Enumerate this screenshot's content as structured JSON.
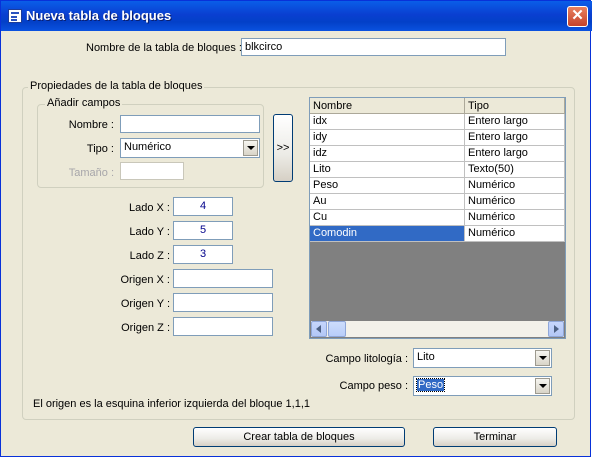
{
  "window": {
    "title": "Nueva tabla de bloques"
  },
  "name_field": {
    "label": "Nombre de la tabla de bloques :",
    "value": "blkcirco"
  },
  "properties_group": {
    "title": "Propiedades de la tabla de bloques"
  },
  "add_fields_group": {
    "title": "Añadir campos",
    "name_label": "Nombre :",
    "name_value": "",
    "type_label": "Tipo :",
    "type_value": "Numérico",
    "size_label": "Tamaño :",
    "size_value": "",
    "add_button_label": ">>"
  },
  "dimensions": {
    "lado_x": {
      "label": "Lado X :",
      "value": "4"
    },
    "lado_y": {
      "label": "Lado Y :",
      "value": "5"
    },
    "lado_z": {
      "label": "Lado Z :",
      "value": "3"
    },
    "origen_x": {
      "label": "Origen X :",
      "value": ""
    },
    "origen_y": {
      "label": "Origen Y :",
      "value": ""
    },
    "origen_z": {
      "label": "Origen Z :",
      "value": ""
    }
  },
  "fields_table": {
    "columns": [
      "Nombre",
      "Tipo"
    ],
    "rows": [
      [
        "idx",
        "Entero largo"
      ],
      [
        "idy",
        "Entero largo"
      ],
      [
        "idz",
        "Entero largo"
      ],
      [
        "Lito",
        "Texto(50)"
      ],
      [
        "Peso",
        "Numérico"
      ],
      [
        "Au",
        "Numérico"
      ],
      [
        "Cu",
        "Numérico"
      ],
      [
        "Comodin",
        "Numérico"
      ]
    ],
    "selected_row": 7
  },
  "campo_litologia": {
    "label": "Campo litología :",
    "value": "Lito"
  },
  "campo_peso": {
    "label": "Campo peso :",
    "value": "Peso"
  },
  "note": "El origen es la esquina inferior izquierda del bloque 1,1,1",
  "buttons": {
    "create": "Crear tabla de bloques",
    "finish": "Terminar"
  }
}
